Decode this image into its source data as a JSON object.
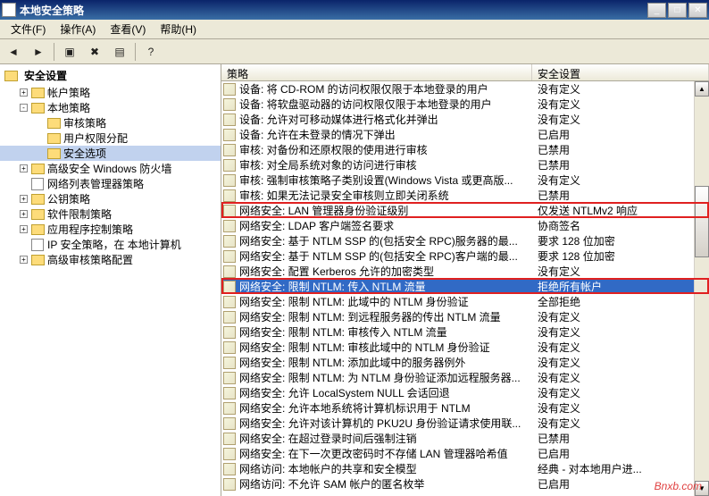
{
  "window": {
    "title": "本地安全策略"
  },
  "menus": [
    "文件(F)",
    "操作(A)",
    "查看(V)",
    "帮助(H)"
  ],
  "tree": {
    "root": "安全设置",
    "nodes": [
      {
        "label": "帐户策略",
        "depth": 1,
        "expand": "+",
        "icon": "folder"
      },
      {
        "label": "本地策略",
        "depth": 1,
        "expand": "-",
        "icon": "folder"
      },
      {
        "label": "审核策略",
        "depth": 2,
        "expand": "",
        "icon": "folder"
      },
      {
        "label": "用户权限分配",
        "depth": 2,
        "expand": "",
        "icon": "folder"
      },
      {
        "label": "安全选项",
        "depth": 2,
        "expand": "",
        "icon": "folder",
        "selected": true
      },
      {
        "label": "高级安全 Windows 防火墙",
        "depth": 1,
        "expand": "+",
        "icon": "folder"
      },
      {
        "label": "网络列表管理器策略",
        "depth": 1,
        "expand": "",
        "icon": "policy"
      },
      {
        "label": "公钥策略",
        "depth": 1,
        "expand": "+",
        "icon": "folder"
      },
      {
        "label": "软件限制策略",
        "depth": 1,
        "expand": "+",
        "icon": "folder"
      },
      {
        "label": "应用程序控制策略",
        "depth": 1,
        "expand": "+",
        "icon": "folder"
      },
      {
        "label": "IP 安全策略，在 本地计算机",
        "depth": 1,
        "expand": "",
        "icon": "policy"
      },
      {
        "label": "高级审核策略配置",
        "depth": 1,
        "expand": "+",
        "icon": "folder"
      }
    ]
  },
  "columns": {
    "policy": "策略",
    "setting": "安全设置"
  },
  "rows": [
    {
      "p": "设备: 将 CD-ROM 的访问权限仅限于本地登录的用户",
      "s": "没有定义"
    },
    {
      "p": "设备: 将软盘驱动器的访问权限仅限于本地登录的用户",
      "s": "没有定义"
    },
    {
      "p": "设备: 允许对可移动媒体进行格式化并弹出",
      "s": "没有定义"
    },
    {
      "p": "设备: 允许在未登录的情况下弹出",
      "s": "已启用"
    },
    {
      "p": "审核: 对备份和还原权限的使用进行审核",
      "s": "已禁用"
    },
    {
      "p": "审核: 对全局系统对象的访问进行审核",
      "s": "已禁用"
    },
    {
      "p": "审核: 强制审核策略子类别设置(Windows Vista 或更高版...",
      "s": "没有定义"
    },
    {
      "p": "审核: 如果无法记录安全审核则立即关闭系统",
      "s": "已禁用"
    },
    {
      "p": "网络安全: LAN 管理器身份验证级别",
      "s": "仅发送 NTLMv2 响应",
      "hl": true
    },
    {
      "p": "网络安全: LDAP 客户端签名要求",
      "s": "协商签名"
    },
    {
      "p": "网络安全: 基于 NTLM SSP 的(包括安全 RPC)服务器的最...",
      "s": "要求 128 位加密"
    },
    {
      "p": "网络安全: 基于 NTLM SSP 的(包括安全 RPC)客户端的最...",
      "s": "要求 128 位加密"
    },
    {
      "p": "网络安全: 配置 Kerberos 允许的加密类型",
      "s": "没有定义"
    },
    {
      "p": "网络安全: 限制 NTLM: 传入 NTLM 流量",
      "s": "拒绝所有帐户",
      "selected": true,
      "hl": true
    },
    {
      "p": "网络安全: 限制 NTLM: 此域中的 NTLM 身份验证",
      "s": "全部拒绝"
    },
    {
      "p": "网络安全: 限制 NTLM: 到远程服务器的传出 NTLM 流量",
      "s": "没有定义"
    },
    {
      "p": "网络安全: 限制 NTLM: 审核传入 NTLM 流量",
      "s": "没有定义"
    },
    {
      "p": "网络安全: 限制 NTLM: 审核此域中的 NTLM 身份验证",
      "s": "没有定义"
    },
    {
      "p": "网络安全: 限制 NTLM: 添加此域中的服务器例外",
      "s": "没有定义"
    },
    {
      "p": "网络安全: 限制 NTLM: 为 NTLM 身份验证添加远程服务器...",
      "s": "没有定义"
    },
    {
      "p": "网络安全: 允许 LocalSystem NULL 会话回退",
      "s": "没有定义"
    },
    {
      "p": "网络安全: 允许本地系统将计算机标识用于 NTLM",
      "s": "没有定义"
    },
    {
      "p": "网络安全: 允许对该计算机的 PKU2U 身份验证请求使用联...",
      "s": "没有定义"
    },
    {
      "p": "网络安全: 在超过登录时间后强制注销",
      "s": "已禁用"
    },
    {
      "p": "网络安全: 在下一次更改密码时不存储 LAN 管理器哈希值",
      "s": "已启用"
    },
    {
      "p": "网络访问: 本地帐户的共享和安全模型",
      "s": "经典 - 对本地用户进..."
    },
    {
      "p": "网络访问: 不允许 SAM 帐户的匿名枚举",
      "s": "已启用"
    }
  ],
  "watermark": "Bnxb.com"
}
